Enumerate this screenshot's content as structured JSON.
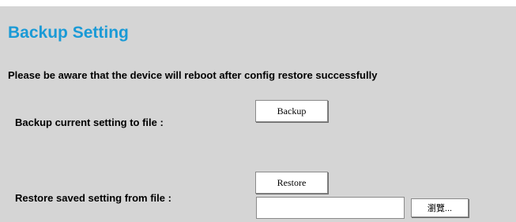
{
  "page": {
    "title": "Backup Setting",
    "notice": "Please be aware that the device will reboot after config restore successfully"
  },
  "backup": {
    "label": "Backup current setting to file :",
    "button_label": "Backup"
  },
  "restore": {
    "label": "Restore saved setting from file :",
    "button_label": "Restore",
    "file_value": "",
    "browse_label": "瀏覽..."
  },
  "colors": {
    "title": "#1a9ad6",
    "panel_background": "#d5d5d5"
  }
}
